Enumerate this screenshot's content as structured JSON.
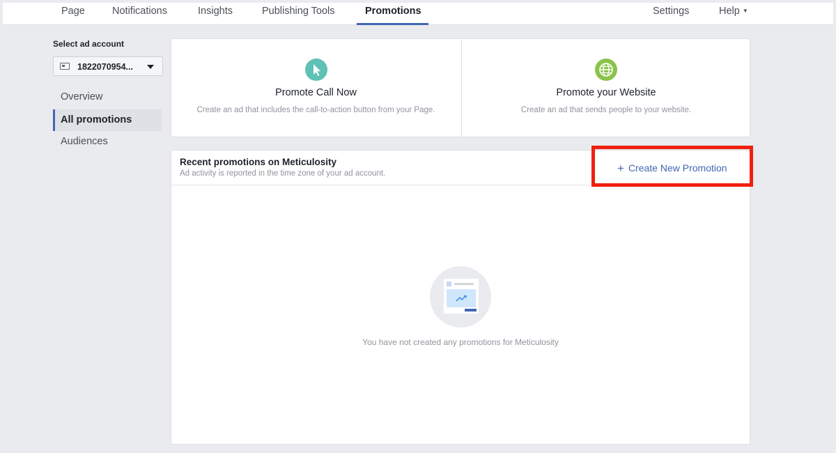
{
  "nav": {
    "tabs": [
      {
        "label": "Page"
      },
      {
        "label": "Notifications"
      },
      {
        "label": "Insights"
      },
      {
        "label": "Publishing Tools"
      },
      {
        "label": "Promotions",
        "active": true
      }
    ],
    "right": [
      {
        "label": "Settings"
      },
      {
        "label": "Help"
      }
    ]
  },
  "sidebar": {
    "select_label": "Select ad account",
    "account_value": "1822070954...",
    "items": [
      {
        "label": "Overview"
      },
      {
        "label": "All promotions",
        "active": true
      },
      {
        "label": "Audiences"
      }
    ]
  },
  "cards": [
    {
      "icon": "cursor-icon",
      "title": "Promote Call Now",
      "desc": "Create an ad that includes the call-to-action button from your Page.",
      "color": "#5ec2b5"
    },
    {
      "icon": "globe-icon",
      "title": "Promote your Website",
      "desc": "Create an ad that sends people to your website.",
      "color": "#8bc34a"
    }
  ],
  "recent": {
    "title": "Recent promotions on Meticulosity",
    "subtitle": "Ad activity is reported in the time zone of your ad account.",
    "create_label": "Create New Promotion",
    "empty_text": "You have not created any promotions for Meticulosity"
  },
  "colors": {
    "accent": "#4267b2",
    "highlight": "#f0200f",
    "background": "#e9ebee"
  }
}
